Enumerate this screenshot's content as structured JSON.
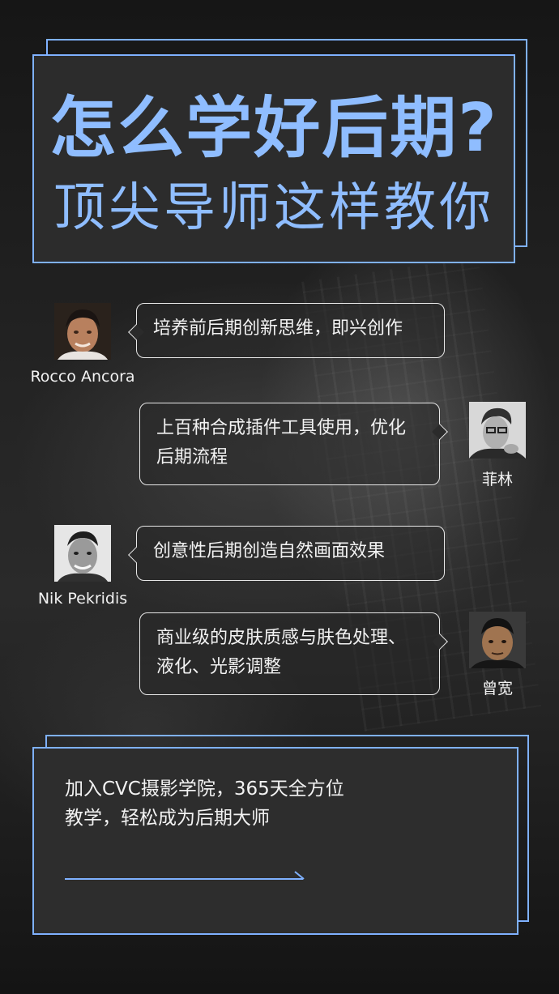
{
  "header": {
    "title": "怎么学好后期?",
    "subtitle": "顶尖导师这样教你"
  },
  "mentors": [
    {
      "name": "Rocco Ancora",
      "text": "培养前后期创新思维，即兴创作",
      "avatar_icon": "portrait-rocco-ancora"
    },
    {
      "name": "菲林",
      "text": "上百种合成插件工具使用，优化后期流程",
      "avatar_icon": "portrait-feilin"
    },
    {
      "name": "Nik Pekridis",
      "text": "创意性后期创造自然画面效果",
      "avatar_icon": "portrait-nik-pekridis"
    },
    {
      "name": "曾宽",
      "text": "商业级的皮肤质感与肤色处理、液化、光影调整",
      "avatar_icon": "portrait-zengkuan"
    }
  ],
  "footer": {
    "text": "加入CVC摄影学院，365天全方位教学，轻松成为后期大师",
    "arrow_icon": "arrow-right-icon"
  },
  "colors": {
    "accent": "#7fb1ff",
    "title": "#8fbdff",
    "background": "#1c1c1c",
    "text": "#f2f2f2"
  }
}
